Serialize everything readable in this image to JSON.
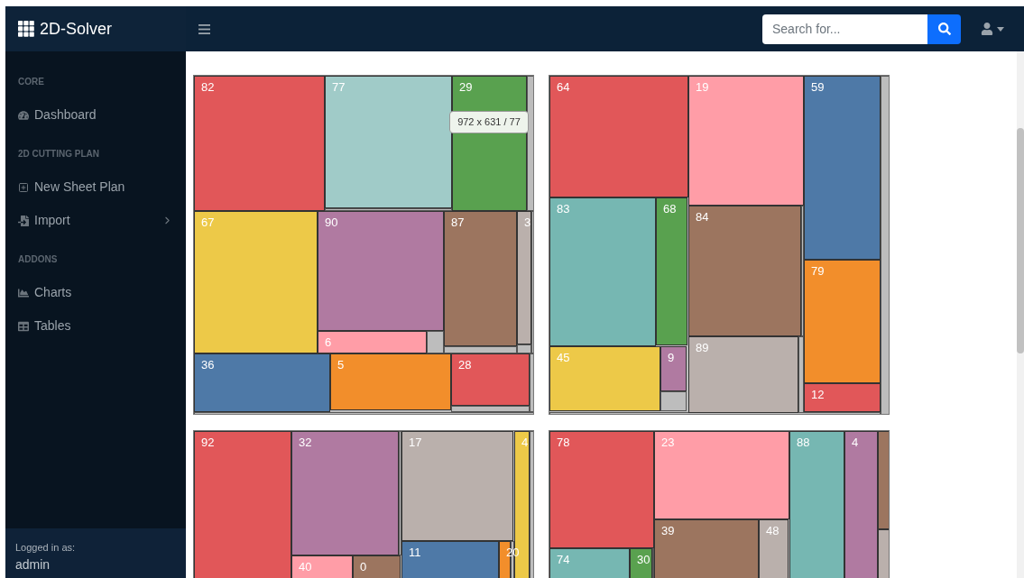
{
  "brand": {
    "title": "2D-Solver"
  },
  "search": {
    "placeholder": "Search for..."
  },
  "sidebar": {
    "sections": [
      {
        "heading": "CORE",
        "items": [
          {
            "label": "Dashboard",
            "expandable": false
          }
        ]
      },
      {
        "heading": "2D CUTTING PLAN",
        "items": [
          {
            "label": "New Sheet Plan",
            "expandable": false
          },
          {
            "label": "Import",
            "expandable": true
          }
        ]
      },
      {
        "heading": "ADDONS",
        "items": [
          {
            "label": "Charts",
            "expandable": false
          },
          {
            "label": "Tables",
            "expandable": false
          }
        ]
      }
    ],
    "footer": {
      "label": "Logged in as:",
      "user": "admin"
    }
  },
  "sheets": [
    {
      "tooltip": "972 x 631 / 77",
      "pieces": [
        {
          "label": "82",
          "color": "#e15759"
        },
        {
          "label": "77",
          "color": "#a0cbc8"
        },
        {
          "label": "29",
          "color": "#59a14f"
        },
        {
          "label": "67",
          "color": "#edc948"
        },
        {
          "label": "90",
          "color": "#b07aa1"
        },
        {
          "label": "6",
          "color": "#ff9da7"
        },
        {
          "label": "87",
          "color": "#9c755f"
        },
        {
          "label": "3",
          "color": "#bab0ac"
        },
        {
          "label": "36",
          "color": "#4e79a7"
        },
        {
          "label": "5",
          "color": "#f28e2b"
        },
        {
          "label": "28",
          "color": "#e15759"
        }
      ]
    },
    {
      "pieces": [
        {
          "label": "64",
          "color": "#e15759"
        },
        {
          "label": "19",
          "color": "#ff9da7"
        },
        {
          "label": "59",
          "color": "#4e79a7"
        },
        {
          "label": "83",
          "color": "#76b7b2"
        },
        {
          "label": "68",
          "color": "#59a14f"
        },
        {
          "label": "45",
          "color": "#edc948"
        },
        {
          "label": "9",
          "color": "#b07aa1"
        },
        {
          "label": "84",
          "color": "#9c755f"
        },
        {
          "label": "89",
          "color": "#bab0ac"
        },
        {
          "label": "79",
          "color": "#f28e2b"
        },
        {
          "label": "12",
          "color": "#e15759"
        }
      ]
    },
    {
      "pieces": [
        {
          "label": "92",
          "color": "#e15759"
        },
        {
          "label": "32",
          "color": "#b07aa1"
        },
        {
          "label": "40",
          "color": "#ff9da7"
        },
        {
          "label": "0",
          "color": "#9c755f"
        },
        {
          "label": "17",
          "color": "#bab0ac"
        },
        {
          "label": "11",
          "color": "#4e79a7"
        },
        {
          "label": "20",
          "color": "#f28e2b"
        },
        {
          "label": "4",
          "color": "#edc948"
        }
      ]
    },
    {
      "pieces": [
        {
          "label": "78",
          "color": "#e15759"
        },
        {
          "label": "74",
          "color": "#76b7b2"
        },
        {
          "label": "30",
          "color": "#59a14f"
        },
        {
          "label": "23",
          "color": "#ff9da7"
        },
        {
          "label": "39",
          "color": "#9c755f"
        },
        {
          "label": "48",
          "color": "#bab0ac"
        },
        {
          "label": "88",
          "color": "#76b7b2"
        },
        {
          "label": "4",
          "color": "#b07aa1"
        },
        {
          "color": "#9c755f"
        },
        {
          "color": "#bab0ac"
        }
      ]
    }
  ]
}
